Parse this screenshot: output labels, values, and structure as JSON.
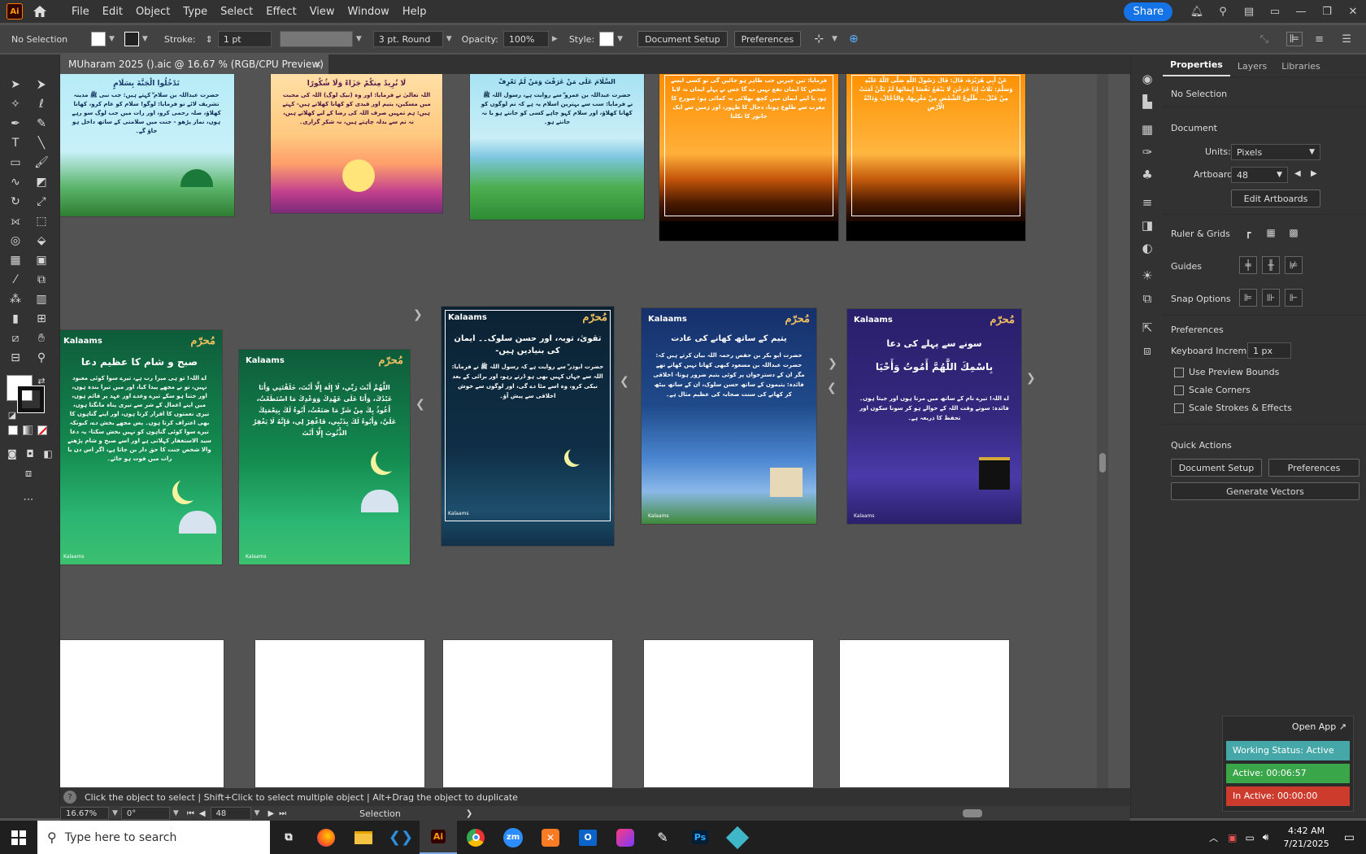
{
  "app": {
    "logo": "Ai",
    "menus": [
      "File",
      "Edit",
      "Object",
      "Type",
      "Select",
      "Effect",
      "View",
      "Window",
      "Help"
    ],
    "share_label": "Share"
  },
  "control_bar": {
    "selection": "No Selection",
    "stroke_label": "Stroke:",
    "stroke_value": "1 pt",
    "brush_value": "3 pt. Round",
    "opacity_label": "Opacity:",
    "opacity_value": "100%",
    "style_label": "Style:",
    "document_setup": "Document Setup",
    "preferences": "Preferences"
  },
  "document_tab": {
    "title": "MUharam 2025 ().aic @ 16.67 % (RGB/CPU Preview)",
    "close": "×"
  },
  "posters": [
    {
      "id": "p1",
      "title": "",
      "body": "حضرت عبداللہ بن سلام ؓ کہتے ہیں: جب نبی ﷺ مدینہ تشریف لائے تو فرمایا: لوگو! سلام کو عام کرو، کھانا کھلاؤ، صلہ رحمی کرو، اور رات میں جب لوگ سو رہے ہوں، نماز پڑھو - جنت میں سلامتی کے ساتھ داخل ہو جاؤ گے۔",
      "top": "تَدْخُلُوا الْجَنَّةَ بِسَلَامٍ",
      "colors": [
        "#b8ecf5",
        "#2e7d32"
      ]
    },
    {
      "id": "p2",
      "title": "",
      "body": "اللہ تعالیٰ نے فرمایا: اور وہ (نیک لوگ) اللہ کی محبت میں مسکین، یتیم اور قیدی کو کھانا کھلاتے ہیں- کہتے ہیں: ہم تمہیں صرف اللہ کی رضا کے لیے کھلاتے ہیں، نہ تم سے بدلہ چاہتے ہیں، نہ شکر گزاری۔",
      "top": "لَا نُرِيدُ مِنكُمْ جَزَاءً وَلَا شُكُورًا",
      "colors": [
        "#ffd39b",
        "#c2418d"
      ]
    },
    {
      "id": "p3",
      "title": "",
      "body": "حضرت عبداللہ بن عمرو ؓ سے روایت ہے، رسول اللہ ﷺ نے فرمایا: سب سے بہترین اسلام یہ ہے کہ تم لوگوں کو کھانا کھلاؤ، اور سلام کہو چاہے کسی کو جانتے ہو یا نہ جانتے ہو۔",
      "top": "السَّلَامَ عَلَى مَنْ عَرَفْتَ وَمَنْ لَمْ تَعْرِفْ",
      "colors": [
        "#9edcf0",
        "#4caf50"
      ]
    },
    {
      "id": "p4",
      "title": "",
      "body": "فرمایا: تین چیزیں جب ظاہر ہو جائیں گی تو کسی ایسے شخص کا ایمان نفع نہیں دے گا جس نے پہلے ایمان نہ لایا ہو، یا اپنے ایمان میں کچھ بھلائی نہ کمائی ہو: سورج کا مغرب سے طلوع ہونا، دجال کا ظہور، اور زمین سے ایک جانور کا نکلنا",
      "top": "",
      "colors": [
        "#ff8c00",
        "#3a1400"
      ]
    },
    {
      "id": "p5",
      "title": "",
      "body": "عَنْ أَبِي هُرَيْرَةَ، قَالَ: قَالَ رَسُولُ اللَّهِ صَلَّى اللَّهُ عَلَيْهِ وَسَلَّمَ: ثَلَاثٌ إِذَا خَرَجْنَ لَا يَنْفَعُ نَفْسًا إِيمَانُهَا لَمْ تَكُنْ آمَنَتْ مِنْ قَبْلُ... طُلُوعُ الشَّمْسِ مِنْ مَغْرِبِهَا، وَالدَّجَّالُ، وَدَابَّةُ الْأَرْضِ",
      "top": "",
      "colors": [
        "#ff9000",
        "#3a1400"
      ]
    },
    {
      "id": "p6",
      "title": "صبح و شام کا عظیم دعا",
      "body": "اے اللہ! تو ہی میرا رب ہے، تیرے سوا کوئی معبود نہیں، تو نے مجھے پیدا کیا، اور میں تیرا بندہ ہوں، اور جتنا ہو سکے تیرے وعدے اور عہد پر قائم ہوں، میں اپنے اعمال کے شر سے تیری پناہ مانگتا ہوں، تیری نعمتوں کا اقرار کرتا ہوں، اور اپنے گناہوں کا بھی اعتراف کرتا ہوں۔ پس مجھے بخش دے، کیونکہ تیرے سوا کوئی گناہوں کو نہیں بخش سکتا- یہ دعا سید الاستغفار کہلاتی ہے اور اسے صبح و شام پڑھنے والا شخص جنت کا حق دار بن جاتا ہے، اگر اس دن یا رات میں فوت ہو جائے۔",
      "top": "",
      "colors": [
        "#0e5b3a",
        "#2bb673"
      ]
    },
    {
      "id": "p7",
      "title": "",
      "body": "اللَّهُمَّ أَنْتَ رَبِّي، لَا إِلَهَ إِلَّا أَنْتَ، خَلَقْتَنِي وَأَنَا عَبْدُكَ، وَأَنَا عَلَى عَهْدِكَ وَوَعْدِكَ مَا اسْتَطَعْتُ، أَعُوذُ بِكَ مِنْ شَرِّ مَا صَنَعْتُ، أَبُوءُ لَكَ بِنِعْمَتِكَ عَلَيَّ، وَأَبُوءُ لَكَ بِذَنْبِي، فَاغْفِرْ لِي، فَإِنَّهُ لَا يَغْفِرُ الذُّنُوبَ إِلَّا أَنْتَ",
      "top": "",
      "colors": [
        "#0e5b3a",
        "#2bb673"
      ]
    },
    {
      "id": "p8",
      "title": "تقویٰ، توبہ، اور حسن سلوک۔۔ ایمان کی بنیادیں ہیں-",
      "body": "حضرت ابوذر ؓ سے روایت ہے کہ رسول اللہ ﷺ نے فرمایا: اللہ سے جہاں کہیں بھی ہو ڈرتے رہو، اور برائی کے بعد نیکی کرو، وہ اسے مٹا دے گی، اور لوگوں سے خوش اخلاقی سے پیش آؤ۔",
      "top": "",
      "colors": [
        "#0b2233",
        "#1d4e6b"
      ]
    },
    {
      "id": "p9",
      "title": "یتیم کے ساتھ کھانے کی عادت",
      "body": "حضرت ابو بکر بن حفص رحمہ اللہ بیان کرتے ہیں کہ: حضرت عبداللہ بن مسعود کبھی کھانا نہیں کھاتے تھے مگر ان کے دسترخوان پر کوئی یتیم ضرور ہوتا- اخلاقی فائدہ: یتیموں کے ساتھ حسن سلوک، ان کے ساتھ بیٹھ کر کھانے کی سنت صحابہ کی عظیم مثال ہے۔",
      "top": "",
      "colors": [
        "#16306b",
        "#4b86d1"
      ]
    },
    {
      "id": "p10",
      "title": "سونے سے پہلے کی دعا",
      "body": "اے اللہ! تیرے نام کے ساتھ میں مرتا ہوں اور جیتا ہوں۔ فائدہ: سوتے وقت اللہ کے حوالے ہو کر سونا سکون اور تحفظ کا ذریعہ ہے۔",
      "top": "بِاسْمِكَ اللَّهُمَّ أَمُوتُ وَأَحْيَا",
      "colors": [
        "#2a1f6b",
        "#4a3aa8"
      ]
    }
  ],
  "brand": "Kalaams",
  "logo_text": "مُحرّم",
  "status_bar": {
    "hint": "Click the object to select  |  Shift+Click to select multiple object  |  Alt+Drag the object to duplicate",
    "zoom": "16.67%",
    "rotation": "0°",
    "artboard": "48",
    "tool": "Selection"
  },
  "properties": {
    "tabs": [
      "Properties",
      "Layers",
      "Libraries"
    ],
    "selection": "No Selection",
    "document_title": "Document",
    "units_label": "Units:",
    "units_value": "Pixels",
    "artboard_label": "Artboard:",
    "artboard_value": "48",
    "edit_artboards": "Edit Artboards",
    "ruler_grids": "Ruler & Grids",
    "guides": "Guides",
    "snap_options": "Snap Options",
    "preferences_title": "Preferences",
    "keyboard_increment_label": "Keyboard Increment:",
    "keyboard_increment_value": "1 px",
    "checks": [
      "Use Preview Bounds",
      "Scale Corners",
      "Scale Strokes & Effects"
    ],
    "quick_actions": "Quick Actions",
    "document_setup": "Document Setup",
    "preferences_btn": "Preferences",
    "generate_vectors": "Generate Vectors"
  },
  "tracker": {
    "open_app": "Open App ↗",
    "working_status": "Working Status: Active",
    "active": "Active: 00:06:57",
    "inactive": "In Active: 00:00:00",
    "colors": {
      "status": "#46a7a8",
      "active": "#3aa64a",
      "inactive": "#cc3b2c"
    }
  },
  "taskbar": {
    "search_placeholder": "Type here to search",
    "time": "4:42 AM",
    "date": "7/21/2025"
  }
}
